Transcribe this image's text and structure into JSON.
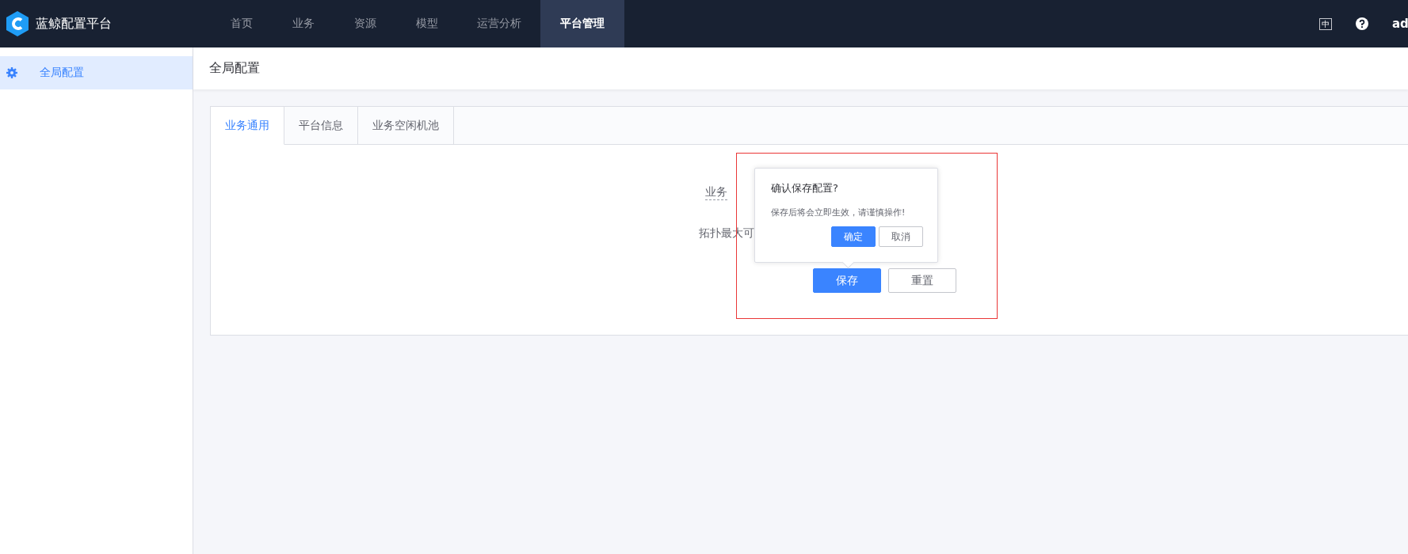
{
  "topbar": {
    "brand": "蓝鲸配置平台",
    "nav": [
      {
        "label": "首页",
        "selected": false
      },
      {
        "label": "业务",
        "selected": false
      },
      {
        "label": "资源",
        "selected": false
      },
      {
        "label": "模型",
        "selected": false
      },
      {
        "label": "运营分析",
        "selected": false
      },
      {
        "label": "平台管理",
        "selected": true
      }
    ],
    "language_icon_text": "中",
    "user": "ad"
  },
  "sidebar": {
    "items": [
      {
        "label": "全局配置",
        "selected": true
      }
    ]
  },
  "header": {
    "title": "全局配置"
  },
  "tabs": [
    {
      "label": "业务通用",
      "selected": true
    },
    {
      "label": "平台信息",
      "selected": false
    },
    {
      "label": "业务空闲机池",
      "selected": false
    }
  ],
  "form": {
    "fields": [
      {
        "label": "业务"
      },
      {
        "label": "拓扑最大可"
      }
    ],
    "buttons": [
      {
        "label": "保存",
        "kind": "primary"
      },
      {
        "label": "重置",
        "kind": "default"
      }
    ]
  },
  "popconfirm": {
    "title": "确认保存配置?",
    "message": "保存后将会立即生效，请谨慎操作!",
    "buttons": [
      {
        "label": "确定",
        "kind": "primary"
      },
      {
        "label": "取消",
        "kind": "default"
      }
    ]
  }
}
